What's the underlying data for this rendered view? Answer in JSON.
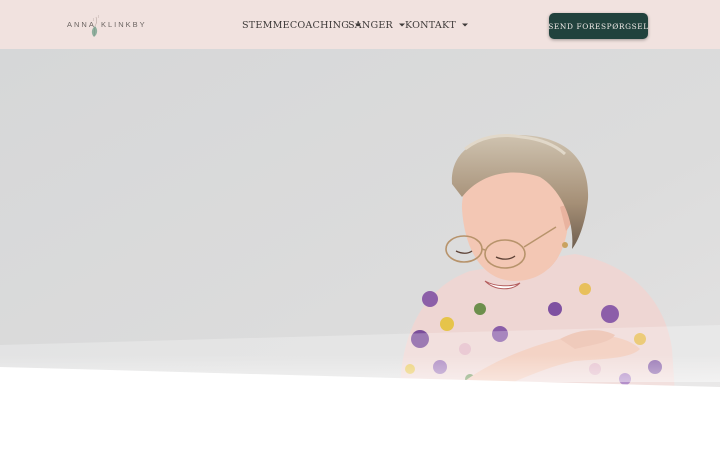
{
  "header": {
    "logo": {
      "first": "ANNA",
      "last": "KLINKBY"
    },
    "nav": [
      {
        "label": "STEMMECOACHING"
      },
      {
        "label": "SANGER"
      },
      {
        "label": "KONTAKT"
      }
    ],
    "cta_label": "SEND  FORESPØRGSEL"
  },
  "colors": {
    "header_bg": "#f1e2df",
    "cta_bg": "#21423d",
    "hero_bg": "#dadada"
  },
  "icons": [
    "leaf-logo-icon",
    "chevron-down-icon"
  ],
  "hero": {
    "image": "woman-smiling-photo"
  }
}
